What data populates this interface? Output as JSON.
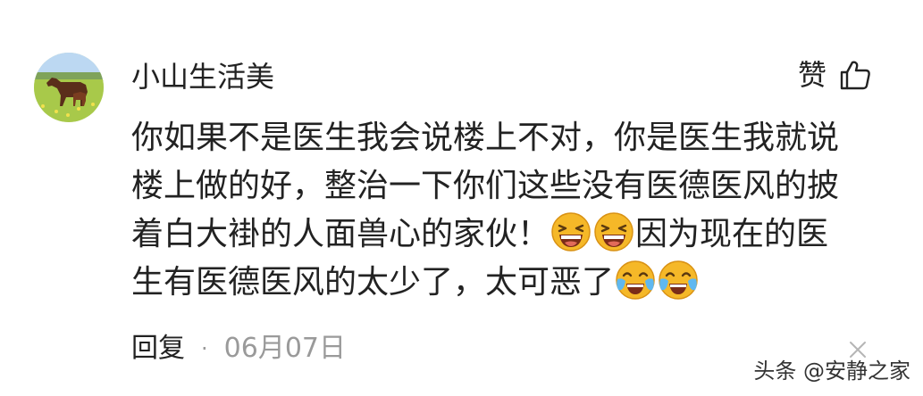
{
  "comment": {
    "username": "小山生活美",
    "like_label": "赞",
    "text_part1": "你如果不是医生我会说楼上不对，你是医生我就说楼上做的好，整治一下你们这些没有医德医风的披着白大褂的人面兽心的家伙！",
    "emoji_laugh": "[大笑]",
    "text_part2": "因为现在的医生有医德医风的太少了，太可恶了",
    "emoji_cry": "[大哭]",
    "reply_label": "回复",
    "separator": "·",
    "date": "06月07日"
  },
  "watermark": {
    "text": "头条 @安静之家"
  },
  "colors": {
    "text": "#222222",
    "muted": "#9a9a9a",
    "emoji_face": "#f5b828"
  },
  "icons": {
    "avatar": "horse-meadow-avatar",
    "like": "thumbs-up-icon",
    "emoji_laugh": "laughing-emoji-icon",
    "emoji_cry": "crying-laughing-emoji-icon",
    "close": "close-icon"
  }
}
